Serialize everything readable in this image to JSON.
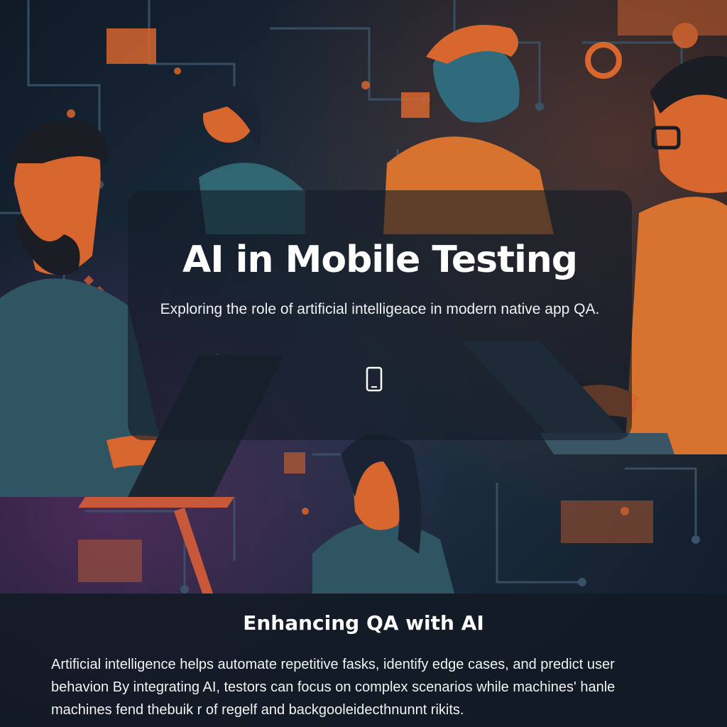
{
  "hero": {
    "title": "AI in Mobile Testing",
    "subtitle": "Exploring the role of artificial intelligeace in modern native app QA.",
    "icon": "smartphone-icon"
  },
  "section": {
    "heading": "Enhancing QA with AI",
    "body": "Artificial intelligence helps automate repetitive fasks, identify edge cases, and predict user behavion By integrating AI, testors can focus on complex scenarios while machines' hanle machines fend thebuik r of regelf and backgooleidecthnunnt rikits."
  },
  "colors": {
    "accent_orange": "#e0672e",
    "background_navy": "#16222f",
    "overlay": "#141c26"
  }
}
